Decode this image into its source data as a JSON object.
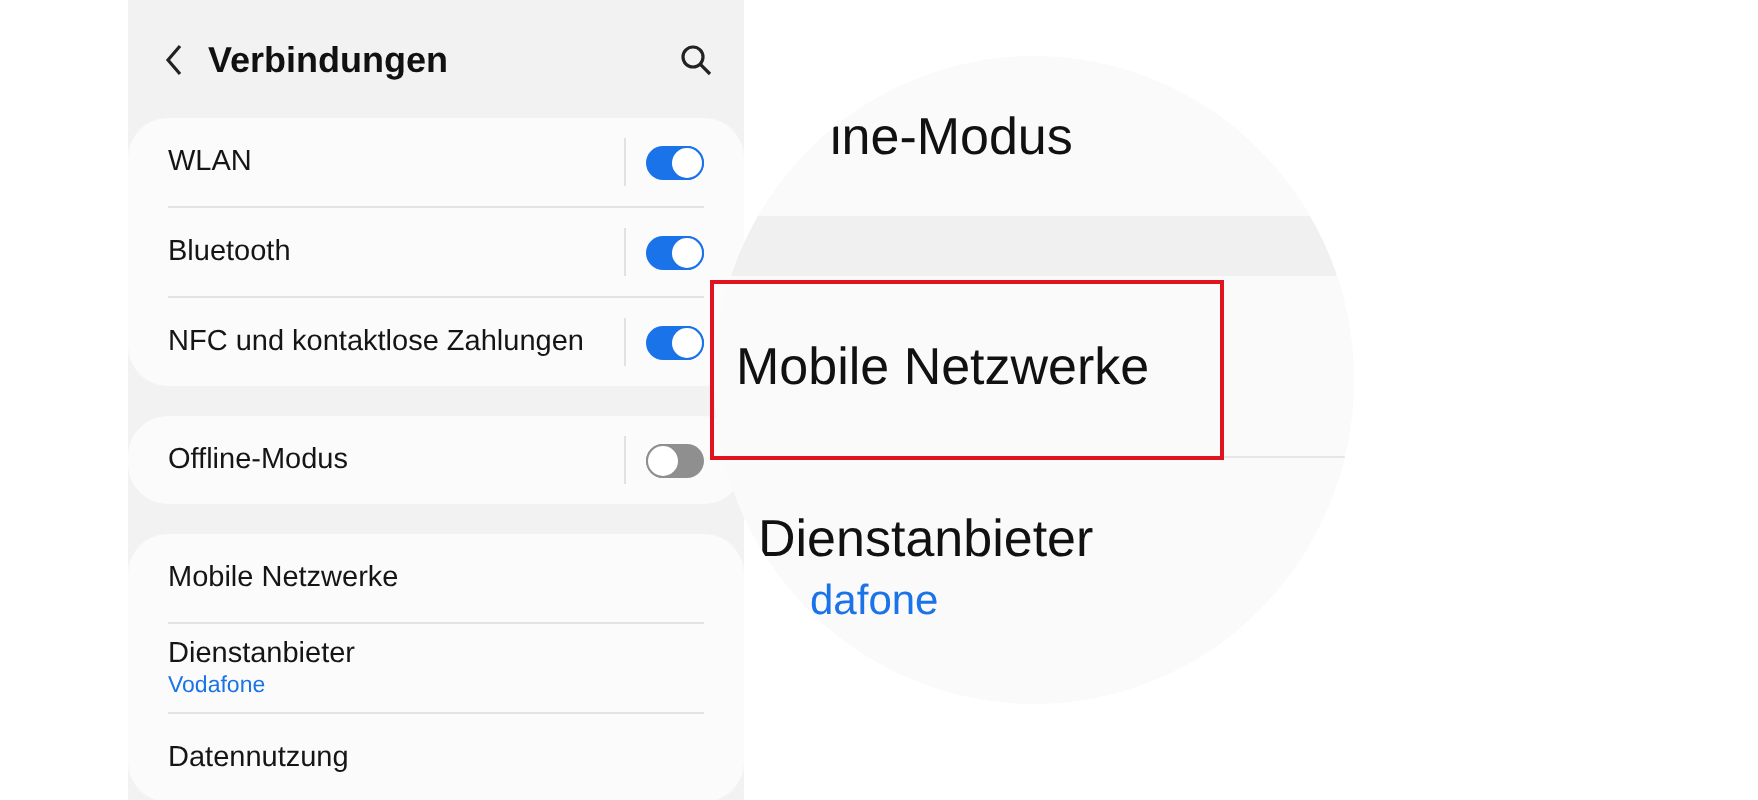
{
  "header": {
    "title": "Verbindungen"
  },
  "groups": [
    {
      "items": [
        {
          "kind": "toggle",
          "label": "WLAN",
          "on": true
        },
        {
          "kind": "toggle",
          "label": "Bluetooth",
          "on": true
        },
        {
          "kind": "toggle",
          "label": "NFC und kontaktlose Zahlungen",
          "on": true
        }
      ]
    },
    {
      "items": [
        {
          "kind": "toggle",
          "label": "Offline-Modus",
          "on": false
        }
      ]
    },
    {
      "items": [
        {
          "kind": "link",
          "label": "Mobile Netzwerke"
        },
        {
          "kind": "link",
          "label": "Dienstanbieter",
          "value": "Vodafone"
        },
        {
          "kind": "link",
          "label": "Datennutzung"
        }
      ]
    }
  ],
  "magnifier": {
    "items": [
      {
        "kind": "toggle",
        "label": "ine-Modus",
        "highlighted": false
      },
      {
        "kind": "link",
        "label": "Mobile Netzwerke",
        "highlighted": true
      },
      {
        "kind": "link",
        "label": "Dienstanbieter",
        "value": "dafone",
        "highlighted": false
      }
    ]
  }
}
